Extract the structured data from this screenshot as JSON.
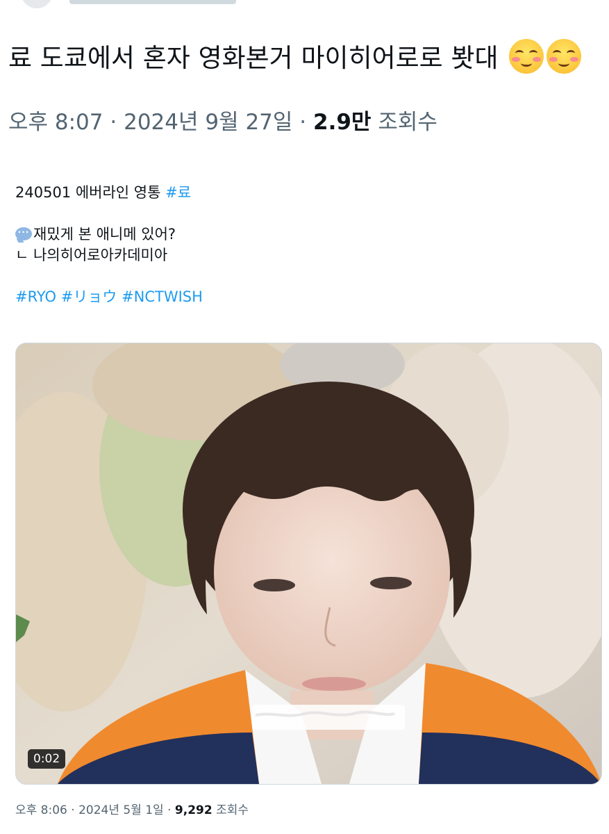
{
  "tweet": {
    "text": "료 도쿄에서 혼자 영화본거 마이히어로로 봣대",
    "emojis": [
      "smiling-face-with-blush-icon",
      "smiling-face-with-blush-icon"
    ],
    "time": "오후 8:07",
    "date": "2024년 9월 27일",
    "views_count": "2.9만",
    "views_label": "조회수",
    "separator": "·"
  },
  "quoted": {
    "line1_text": "240501 에버라인 영통",
    "line1_hashtag": "#료",
    "question": "재밌게 본 애니메 있어?",
    "answer": "ㄴ 나의히어로아카데미아",
    "hashtags": [
      "#RYO",
      "#リョウ",
      "#NCTWISH"
    ],
    "video": {
      "duration": "0:02"
    },
    "time": "오후 8:06",
    "date": "2024년 5월 1일",
    "views_count": "9,292",
    "views_label": "조회수"
  },
  "colors": {
    "link": "#1d9bf0",
    "secondary_text": "#536471",
    "primary_text": "#0f1419",
    "jacket_orange": "#f08a2e",
    "jacket_navy": "#22305c"
  }
}
